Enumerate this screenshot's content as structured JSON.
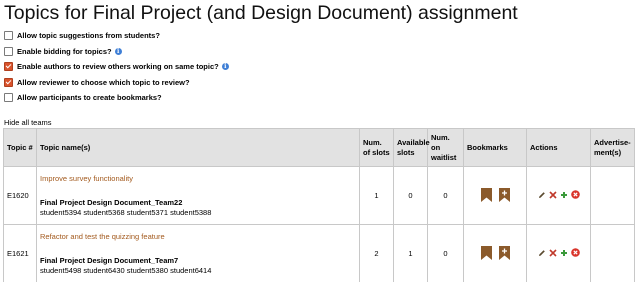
{
  "page": {
    "title": "Topics for Final Project (and Design Document) assignment"
  },
  "options": [
    {
      "label": "Allow topic suggestions from students?",
      "checked": false,
      "info": false
    },
    {
      "label": "Enable bidding for topics?",
      "checked": false,
      "info": true
    },
    {
      "label": "Enable authors to review others working on same topic?",
      "checked": true,
      "info": true
    },
    {
      "label": "Allow reviewer to choose which topic to review?",
      "checked": true,
      "info": false
    },
    {
      "label": "Allow participants to create bookmarks?",
      "checked": false,
      "info": false
    }
  ],
  "hide_teams_label": "Hide all teams",
  "table": {
    "headers": {
      "topic_num": "Topic #",
      "topic_name": "Topic name(s)",
      "num_slots": "Num. of slots",
      "available_slots": "Available slots",
      "num_waitlist": "Num. on waitlist",
      "bookmarks": "Bookmarks",
      "actions": "Actions",
      "advertisements": "Advertise-ment(s)"
    },
    "rows": [
      {
        "id": "E1620",
        "topic": "Improve survey functionality",
        "team": "Final Project Design Document_Team22",
        "members": "student5394 student5368 student5371 student5388",
        "num_slots": "1",
        "available": "0",
        "waitlist": "0"
      },
      {
        "id": "E1621",
        "topic": "Refactor and test the quizzing feature",
        "team": "Final Project Design Document_Team7",
        "members": "student5498 student6430 student5380 student6414",
        "num_slots": "2",
        "available": "1",
        "waitlist": "0"
      }
    ]
  },
  "colors": {
    "accent": "#d9532c",
    "link": "#a35a1e",
    "bookmark": "#8b5a2b",
    "header_bg": "#e2e2e2",
    "edit": "#5b4a2f",
    "delete": "#c0392b",
    "add": "#3a9a3a",
    "remove": "#d9342b"
  },
  "icons": {
    "bookmark_view": "bookmark-icon",
    "bookmark_add": "bookmark-add-icon",
    "edit": "pencil-icon",
    "delete": "x-icon",
    "add": "plus-icon",
    "remove": "circle-x-icon"
  }
}
